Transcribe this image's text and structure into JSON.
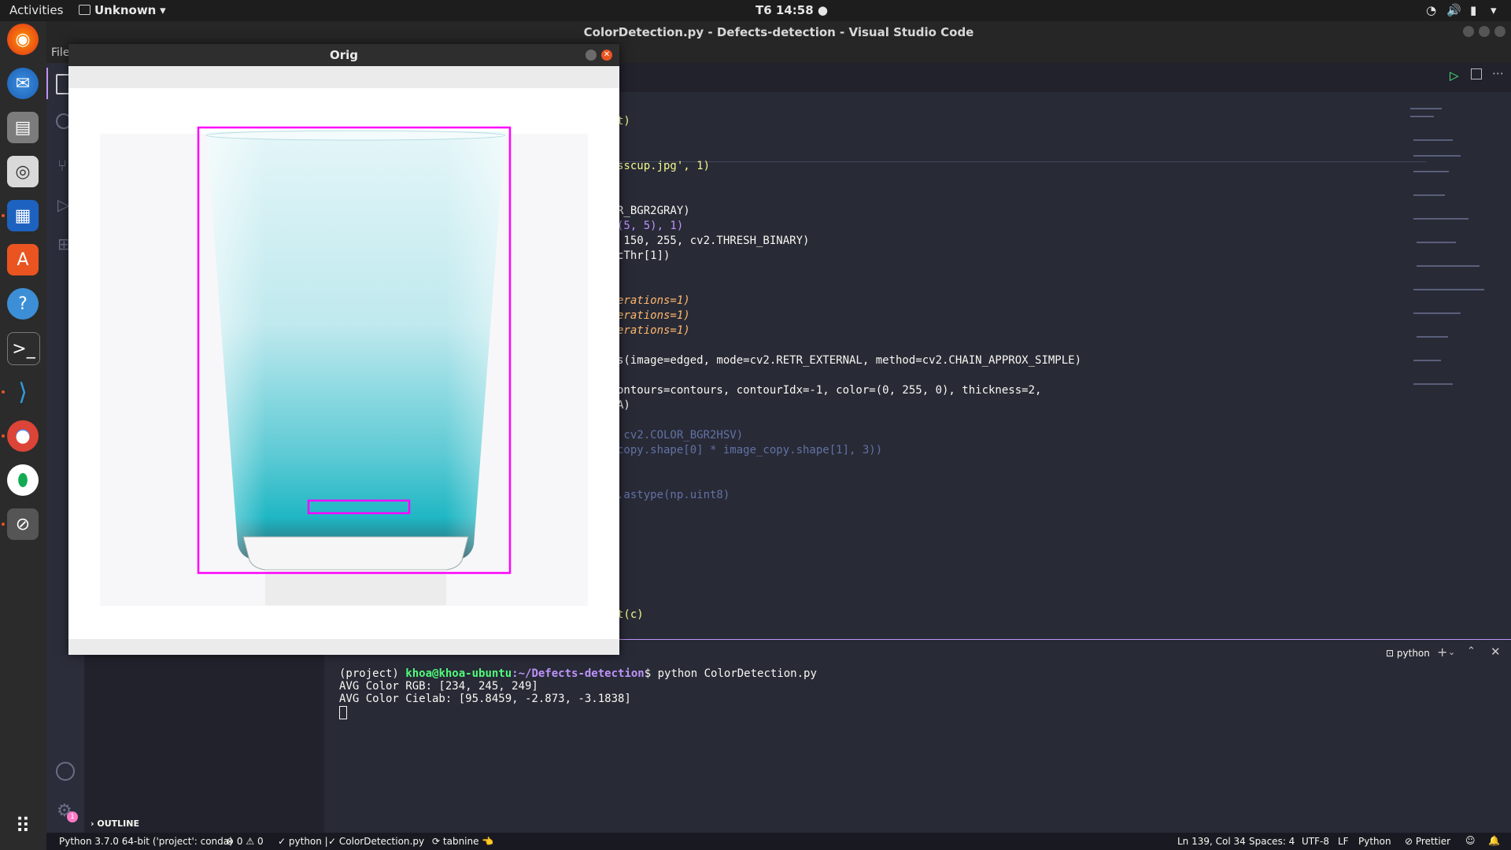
{
  "topbar": {
    "activities": "Activities",
    "app_menu": "Unknown",
    "clock": "T6 14:58"
  },
  "vscode": {
    "title": "ColorDetection.py - Defects-detection - Visual Studio Code",
    "menu_file": "File",
    "outline_label": "OUTLINE"
  },
  "editor": {
    "lines": [
      {
        "frag": "t)"
      },
      {
        "frag": "sscup.jpg', 1)"
      },
      {
        "frag": "R_BGR2GRAY)"
      },
      {
        "frag": "(5, 5), 1)"
      },
      {
        "frag": " 150, 255, cv2.THRESH_BINARY)"
      },
      {
        "frag": "cThr[1])"
      },
      {
        "frag": "erations=1)"
      },
      {
        "frag": "erations=1)"
      },
      {
        "frag": "erations=1)"
      },
      {
        "frag": "s(image=edged, mode=cv2.RETR_EXTERNAL, method=cv2.CHAIN_APPROX_SIMPLE)"
      },
      {
        "frag": "ontours=contours, contourIdx=-1, color=(0, 255, 0), thickness=2,"
      },
      {
        "frag": "A)"
      },
      {
        "frag": " cv2.COLOR_BGR2HSV)"
      },
      {
        "frag": "copy.shape[0] * image_copy.shape[1], 3))"
      },
      {
        "frag": ".astype(np.uint8)"
      },
      {
        "frag": "t(c)"
      }
    ]
  },
  "terminal": {
    "tab_label": "python",
    "prompt_env": "(project) ",
    "prompt_user": "khoa@khoa-ubuntu",
    "prompt_path": ":~/Defects-detection",
    "prompt_cmd": "$ python ColorDetection.py",
    "line1": "AVG Color RGB: [234, 245, 249]",
    "line2": "AVG Color Cielab: [95.8459, -2.873, -3.1838]"
  },
  "statusbar": {
    "interpreter": "Python 3.7.0 64-bit ('project': conda)",
    "errors": "0",
    "warnings": "0",
    "python_check": "python |",
    "file_check": "ColorDetection.py",
    "tabnine": "tabnine",
    "position": "Ln 139, Col 34",
    "spaces": "Spaces: 4",
    "encoding": "UTF-8",
    "eol": "LF",
    "language": "Python",
    "prettier": "Prettier"
  },
  "orig_window": {
    "title": "Orig"
  },
  "colors": {
    "accent_magenta": "#ff00ff",
    "glass_cyan": "#1fb7c4"
  }
}
